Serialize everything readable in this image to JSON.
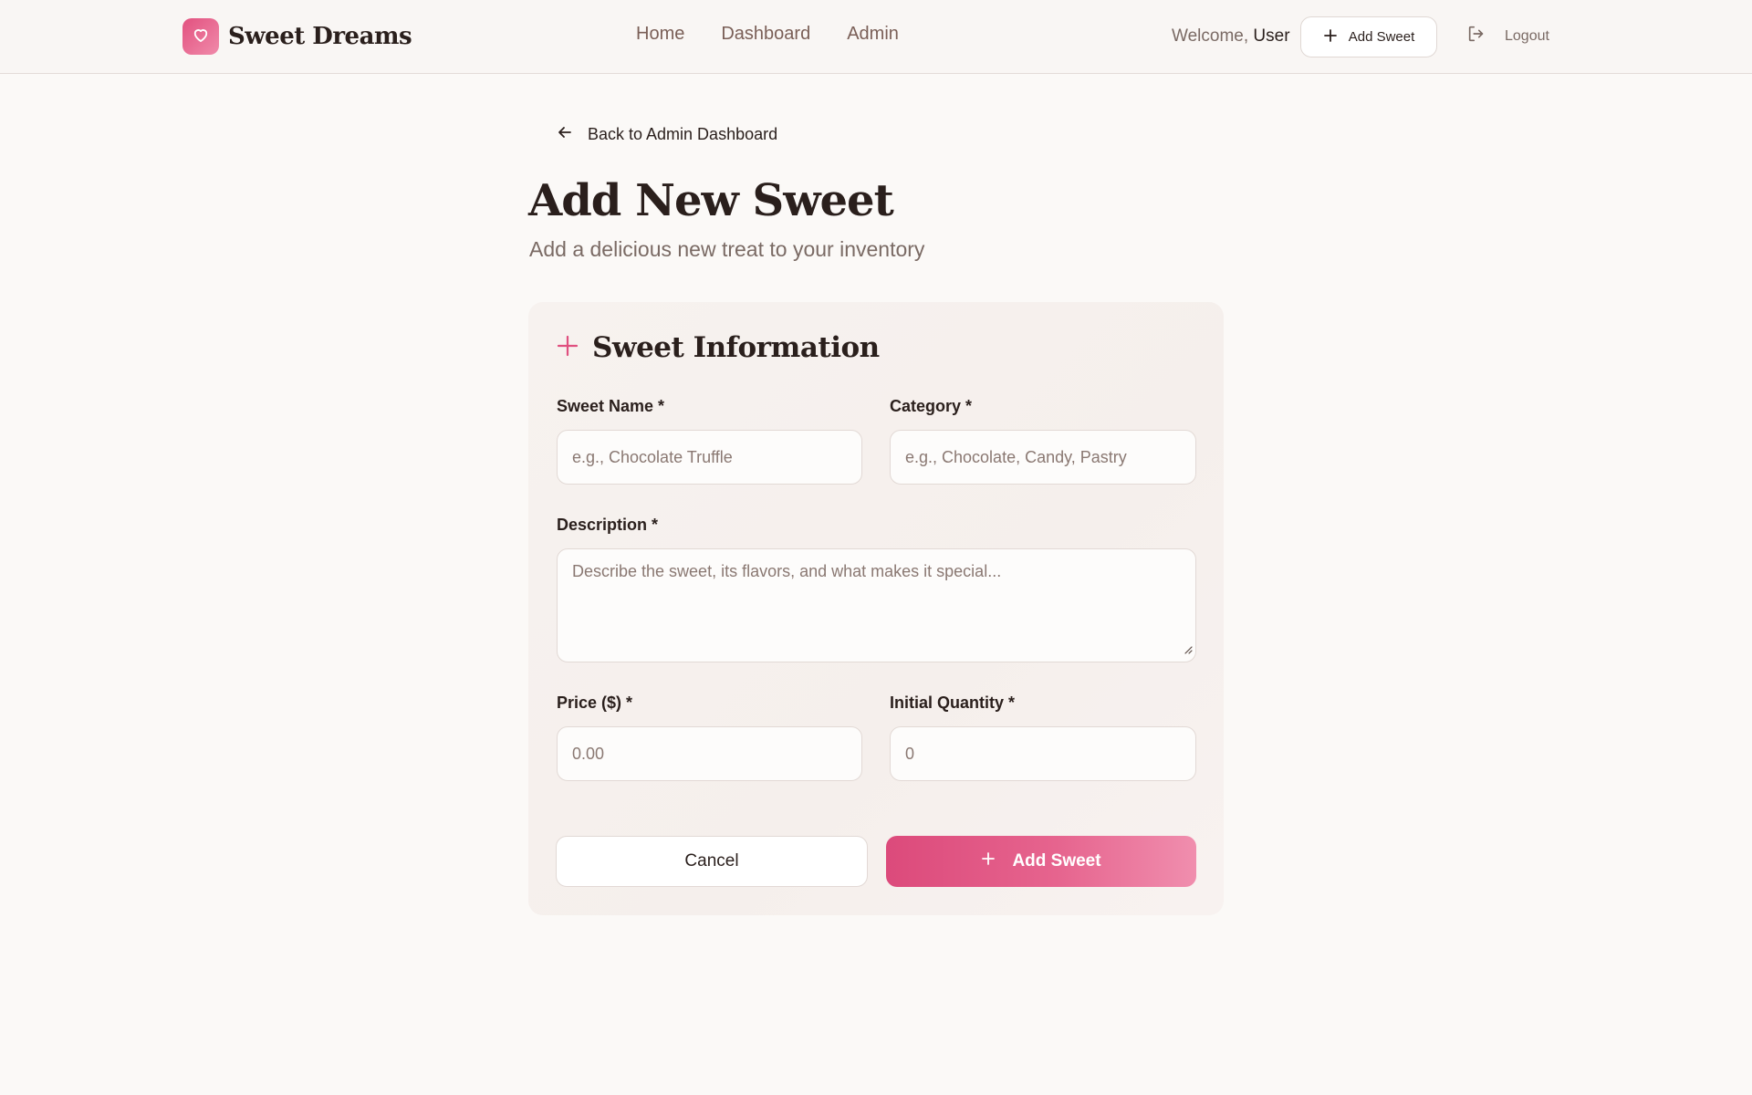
{
  "header": {
    "brand_name": "Sweet Dreams",
    "brand_icon": "heart-icon",
    "nav": [
      {
        "label": "Home"
      },
      {
        "label": "Dashboard"
      },
      {
        "label": "Admin"
      }
    ],
    "welcome_prefix": "Welcome,",
    "user_name": "User",
    "add_sweet_label": "Add Sweet",
    "logout_label": "Logout"
  },
  "page": {
    "back_label": "Back to Admin Dashboard",
    "title": "Add New Sweet",
    "subtitle": "Add a delicious new treat to your inventory"
  },
  "form": {
    "section_title": "Sweet Information",
    "fields": {
      "name": {
        "label": "Sweet Name *",
        "placeholder": "e.g., Chocolate Truffle",
        "value": ""
      },
      "category": {
        "label": "Category *",
        "placeholder": "e.g., Chocolate, Candy, Pastry",
        "value": ""
      },
      "description": {
        "label": "Description *",
        "placeholder": "Describe the sweet, its flavors, and what makes it special...",
        "value": ""
      },
      "price": {
        "label": "Price ($) *",
        "placeholder": "0.00",
        "value": ""
      },
      "quantity": {
        "label": "Initial Quantity *",
        "placeholder": "0",
        "value": ""
      }
    },
    "cancel_label": "Cancel",
    "submit_label": "Add Sweet"
  },
  "colors": {
    "accent": "#e0507f",
    "accent_light": "#f08eae",
    "background": "#fbf9f7",
    "text": "#2a1f1c",
    "muted": "#7a6a64"
  }
}
